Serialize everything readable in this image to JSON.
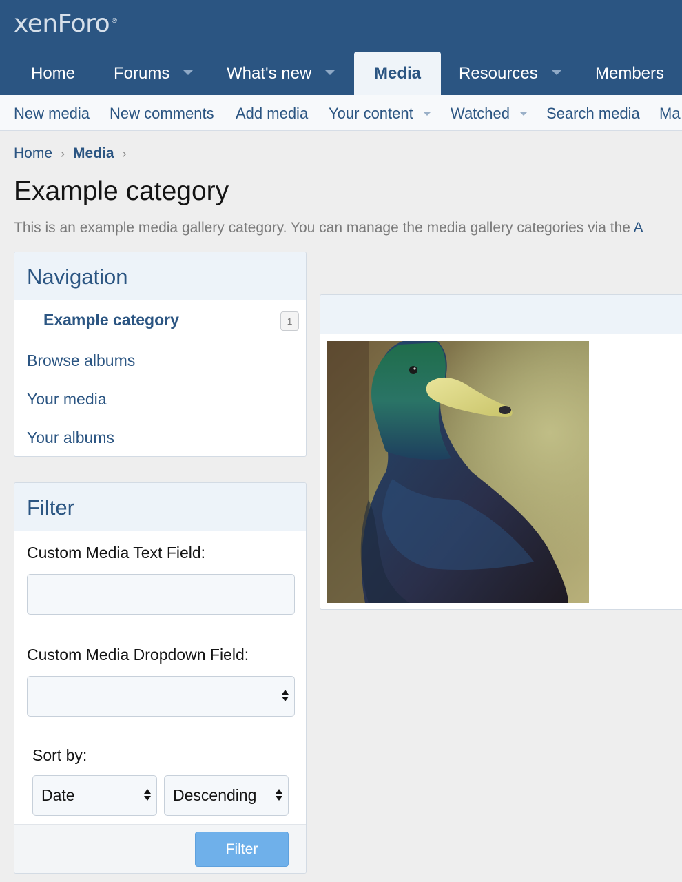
{
  "header": {
    "logo": "xenForo",
    "logo_mark": "®"
  },
  "nav": {
    "items": [
      {
        "label": "Home"
      },
      {
        "label": "Forums"
      },
      {
        "label": "What's new"
      },
      {
        "label": "Media"
      },
      {
        "label": "Resources"
      },
      {
        "label": "Members"
      }
    ],
    "active": "Media"
  },
  "subnav": {
    "items": [
      {
        "label": "New media"
      },
      {
        "label": "New comments"
      },
      {
        "label": "Add media"
      },
      {
        "label": "Your content"
      },
      {
        "label": "Watched"
      },
      {
        "label": "Search media"
      },
      {
        "label": "Ma"
      }
    ]
  },
  "breadcrumb": [
    {
      "label": "Home"
    },
    {
      "label": "Media"
    }
  ],
  "page": {
    "title": "Example category",
    "description": "This is an example media gallery category. You can manage the media gallery categories via the ",
    "description_link": "A"
  },
  "navigation": {
    "title": "Navigation",
    "category": {
      "label": "Example category",
      "count": "1"
    },
    "links": [
      {
        "label": "Browse albums"
      },
      {
        "label": "Your media"
      },
      {
        "label": "Your albums"
      }
    ]
  },
  "filter": {
    "title": "Filter",
    "text_field_label": "Custom Media Text Field:",
    "text_field_value": "",
    "dropdown_label": "Custom Media Dropdown Field:",
    "dropdown_value": "",
    "sort_label": "Sort by:",
    "sort_field": "Date",
    "sort_direction": "Descending",
    "button": "Filter"
  },
  "media": {
    "thumbnail_icon": "duck-photo-icon"
  },
  "colors": {
    "header_bg": "#2b5582",
    "link": "#2b5582",
    "button": "#6fb0ea",
    "page_bg": "#eeeeee"
  }
}
